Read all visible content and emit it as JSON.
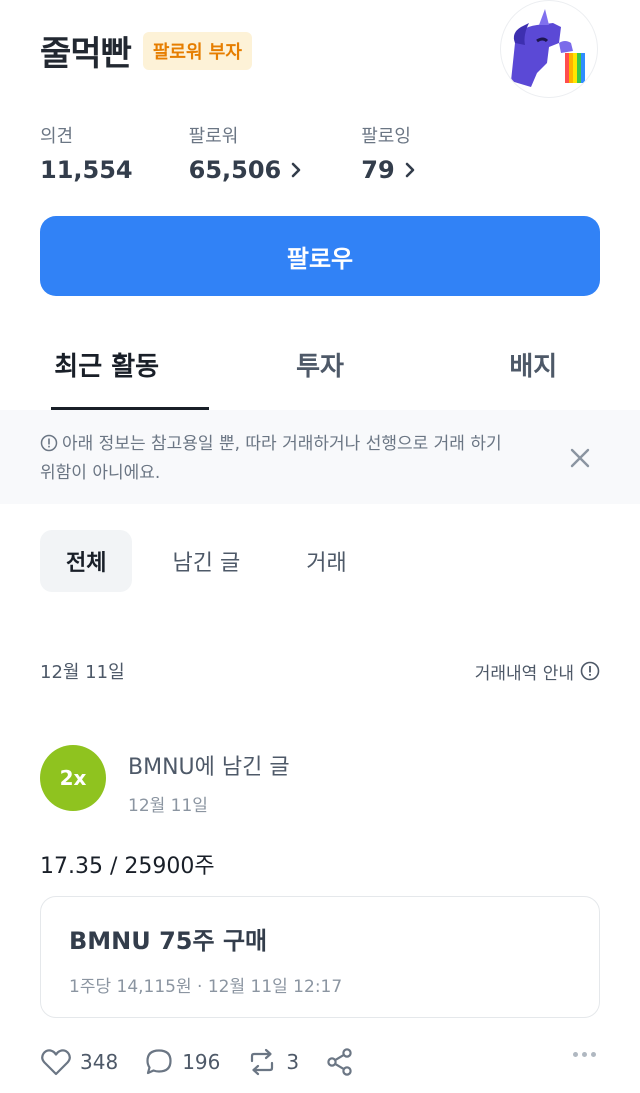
{
  "profile": {
    "name": "줄먹빤",
    "badge": "팔로워 부자",
    "stats": [
      {
        "label": "의견",
        "value": "11,554"
      },
      {
        "label": "팔로워",
        "value": "65,506"
      },
      {
        "label": "팔로잉",
        "value": "79"
      }
    ],
    "follow_label": "팔로우"
  },
  "tabs": [
    "최근 활동",
    "투자",
    "배지"
  ],
  "notice": {
    "text": "아래 정보는 참고용일 뿐, 따라 거래하거나 선행으로 거래 하기 위함이 아니에요."
  },
  "filters": [
    "전체",
    "남긴 글",
    "거래"
  ],
  "feed": {
    "date": "12월 11일",
    "guide_label": "거래내역 안내",
    "post": {
      "avatar_text": "2x",
      "title": "BMNU에 남긴 글",
      "date": "12월 11일",
      "body": "17.35 / 25900주",
      "trade_title": "BMNU 75주 구매",
      "trade_sub": "1주당 14,115원 · 12월 11일 12:17",
      "likes": "348",
      "comments": "196",
      "reposts": "3"
    }
  },
  "colors": {
    "accent": "#3182f6",
    "badge_bg": "#fdf2d7",
    "badge_text": "#e67e00",
    "post_avatar": "#8fc31f"
  }
}
